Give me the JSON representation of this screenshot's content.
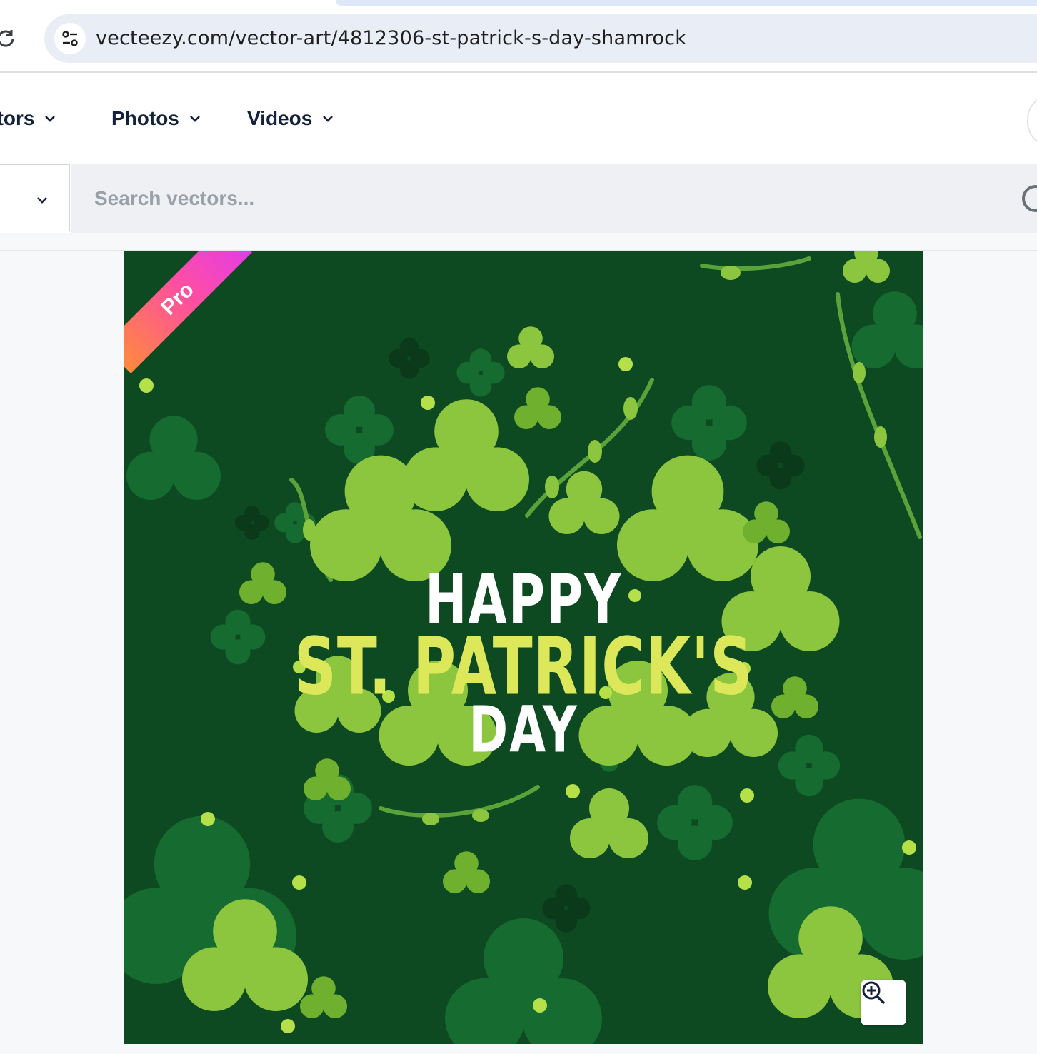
{
  "browser": {
    "url": "vecteezy.com/vector-art/4812306-st-patrick-s-day-shamrock"
  },
  "nav": {
    "items": [
      {
        "label": "ctors"
      },
      {
        "label": "Photos"
      },
      {
        "label": "Videos"
      }
    ]
  },
  "search": {
    "placeholder": "Search vectors..."
  },
  "artwork": {
    "badge": "Pro",
    "line1": "HAPPY",
    "line2": "ST. PATRICK'S",
    "line3": "DAY",
    "colors": {
      "background": "#0d4a22",
      "leaf_light": "#8cc63f",
      "leaf_dark": "#166b30",
      "title_accent": "#dce85a"
    }
  }
}
